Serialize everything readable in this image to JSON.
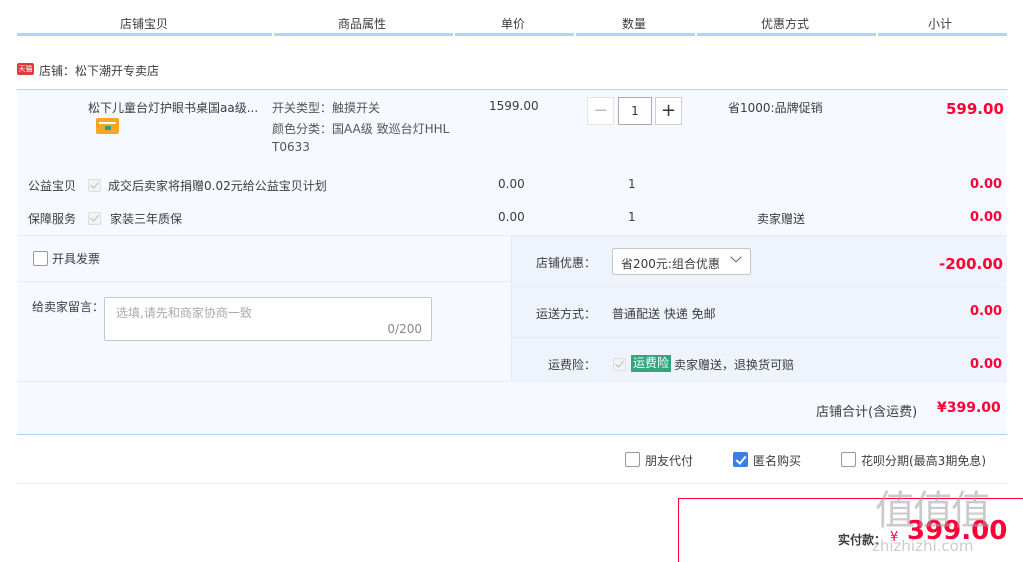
{
  "header": {
    "columns": [
      "店铺宝贝",
      "商品属性",
      "单价",
      "数量",
      "优惠方式",
      "小计"
    ]
  },
  "shop": {
    "badge": "天猫",
    "name": "店铺：松下潮开专卖店"
  },
  "item": {
    "title": "松下儿童台灯护眼书桌国aa级...",
    "attr1": "开关类型：触摸开关",
    "attr2": "颜色分类：国AA级 致巡台灯HHL",
    "attr3": "T0633",
    "unit_price": "1599.00",
    "quantity": "1",
    "minus": "−",
    "plus": "+",
    "discount": "省1000:品牌促销",
    "subtotal": "599.00"
  },
  "charity": {
    "label": "公益宝贝",
    "text": "成交后卖家将捐赠0.02元给公益宝贝计划",
    "price": "0.00",
    "qty": "1",
    "subtotal": "0.00"
  },
  "warranty": {
    "label": "保障服务",
    "text": "家装三年质保",
    "price": "0.00",
    "qty": "1",
    "discount": "卖家赠送",
    "subtotal": "0.00"
  },
  "invoice": {
    "label": "开具发票"
  },
  "message": {
    "label": "给卖家留言：",
    "placeholder": "选填,请先和商家协商一致",
    "counter": "0/200"
  },
  "shop_discount": {
    "label": "店铺优惠：",
    "selected": "省200元:组合优惠",
    "amount": "-200.00"
  },
  "shipping": {
    "label": "运送方式：",
    "value": "普通配送 快递 免邮",
    "amount": "0.00"
  },
  "insurance": {
    "label": "运费险：",
    "tag": "运费险",
    "text": "卖家赠送，退换货可赔",
    "amount": "0.00"
  },
  "shop_total": {
    "label": "店铺合计(含运费)",
    "amount": "¥399.00"
  },
  "options": {
    "friend_pay": "朋友代付",
    "anonymous": "匿名购买",
    "huabei": "花呗分期(最高3期免息)"
  },
  "payment": {
    "label": "实付款：",
    "currency": "¥",
    "amount": "399.00"
  },
  "watermark": {
    "logo": "值值值",
    "site": "zhizhizhi.com"
  },
  "colors": {
    "accent_red": "#ff0036",
    "header_line": "#b2d1ff",
    "panel_bg": "#f6f9ff",
    "checkbox_blue": "#3b7de9",
    "insurance_green": "#2fa67e"
  }
}
